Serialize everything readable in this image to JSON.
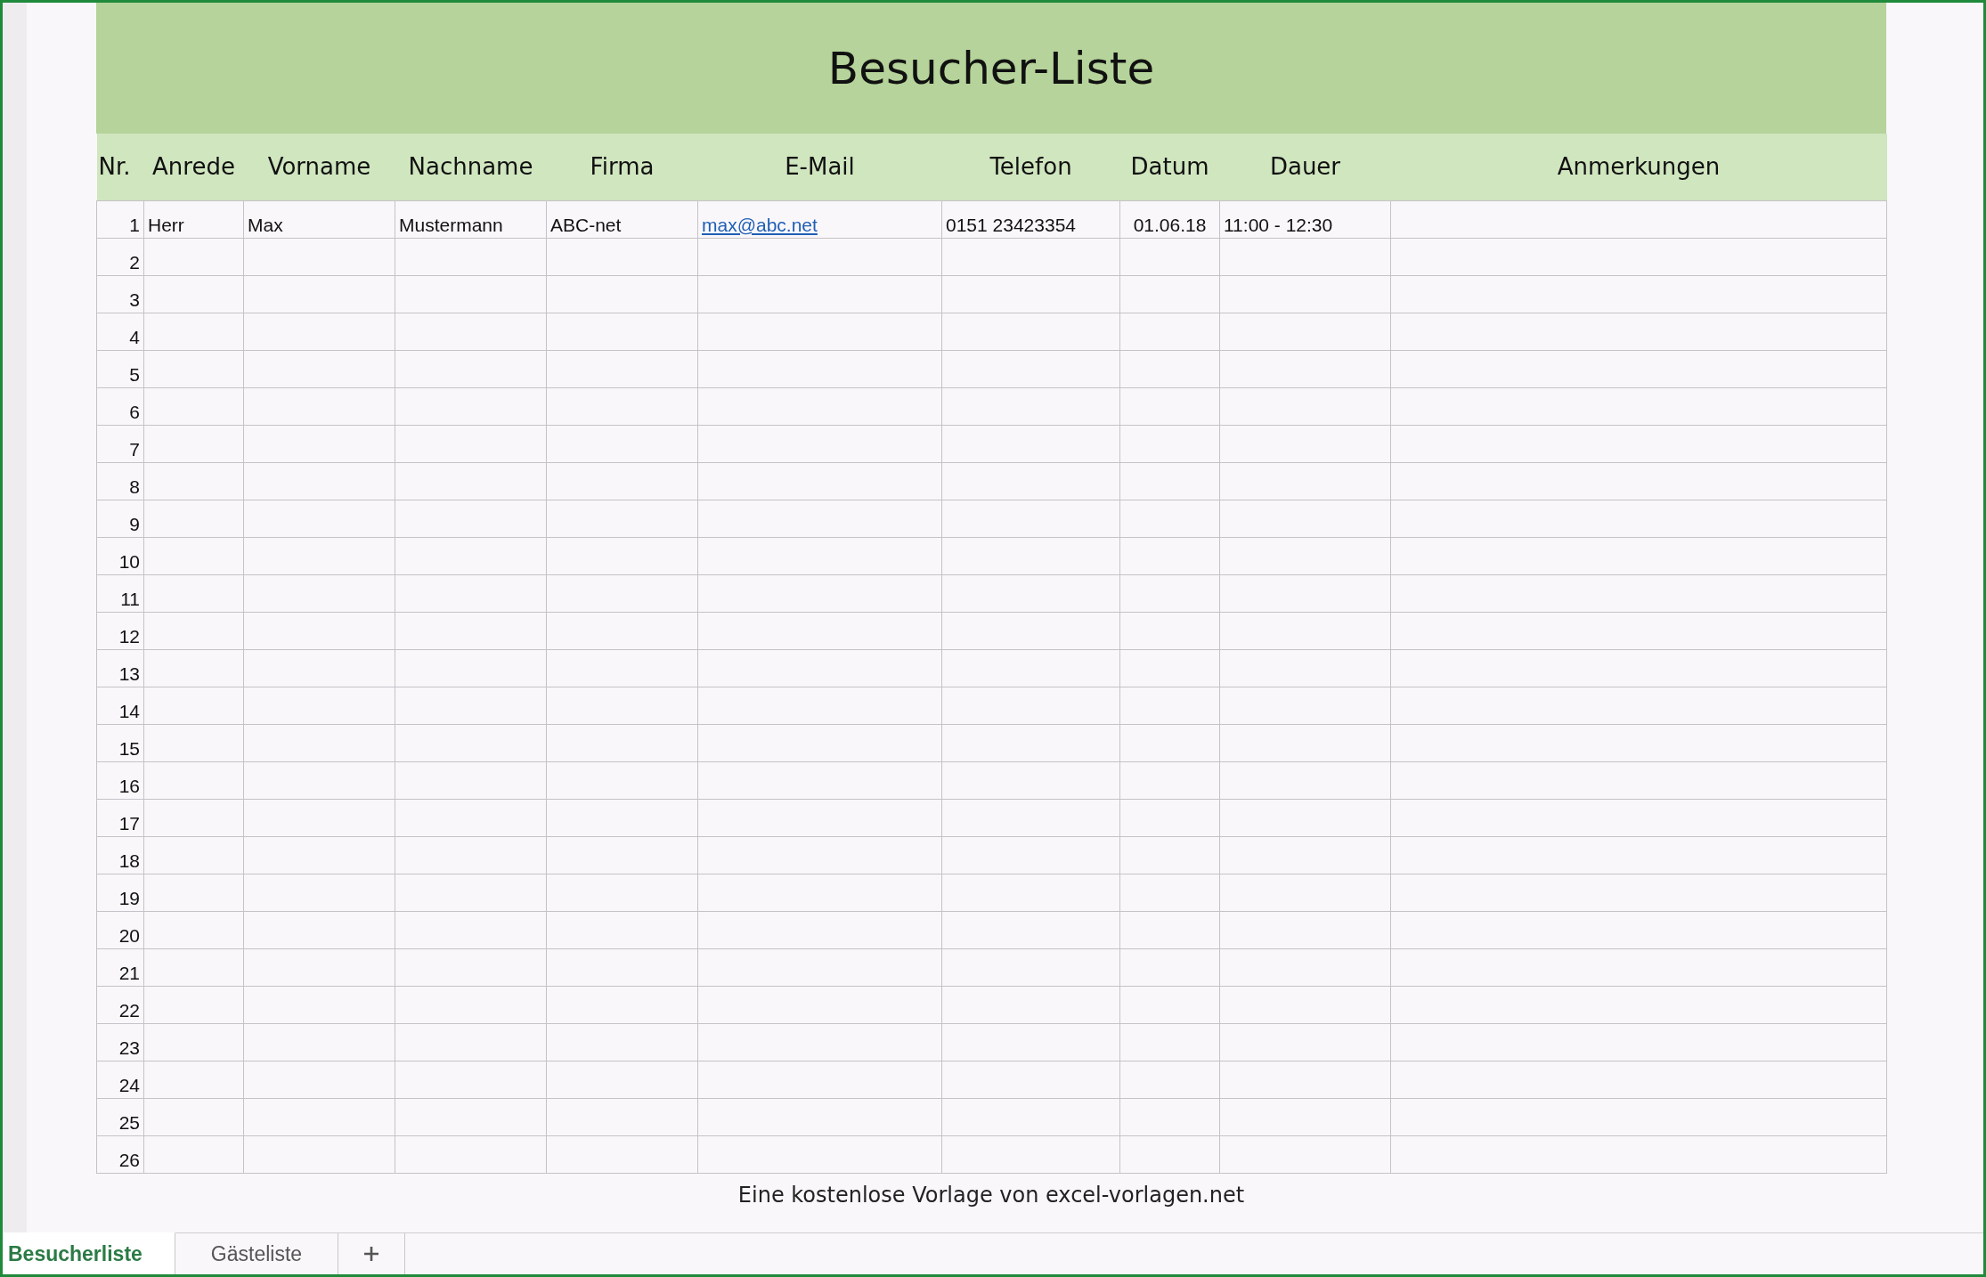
{
  "title": "Besucher-Liste",
  "columns": [
    {
      "label": "Nr.",
      "kind": "number"
    },
    {
      "label": "Anrede",
      "kind": "text"
    },
    {
      "label": "Vorname",
      "kind": "text"
    },
    {
      "label": "Nachname",
      "kind": "text"
    },
    {
      "label": "Firma",
      "kind": "text"
    },
    {
      "label": "E-Mail",
      "kind": "link"
    },
    {
      "label": "Telefon",
      "kind": "text"
    },
    {
      "label": "Datum",
      "kind": "center"
    },
    {
      "label": "Dauer",
      "kind": "text"
    },
    {
      "label": "Anmerkungen",
      "kind": "text"
    }
  ],
  "rows": [
    {
      "cells": [
        "1",
        "Herr",
        "Max",
        "Mustermann",
        "ABC-net",
        "max@abc.net",
        "0151 23423354",
        "01.06.18",
        "11:00 - 12:30"
      ]
    },
    {
      "cells": [
        "2"
      ]
    },
    {
      "cells": [
        "3"
      ]
    },
    {
      "cells": [
        "4"
      ]
    },
    {
      "cells": [
        "5"
      ]
    },
    {
      "cells": [
        "6"
      ]
    },
    {
      "cells": [
        "7"
      ]
    },
    {
      "cells": [
        "8"
      ]
    },
    {
      "cells": [
        "9"
      ]
    },
    {
      "cells": [
        "10"
      ]
    },
    {
      "cells": [
        "11"
      ]
    },
    {
      "cells": [
        "12"
      ]
    },
    {
      "cells": [
        "13"
      ]
    },
    {
      "cells": [
        "14"
      ]
    },
    {
      "cells": [
        "15"
      ]
    },
    {
      "cells": [
        "16"
      ]
    },
    {
      "cells": [
        "17"
      ]
    },
    {
      "cells": [
        "18"
      ]
    },
    {
      "cells": [
        "19"
      ]
    },
    {
      "cells": [
        "20"
      ]
    },
    {
      "cells": [
        "21"
      ]
    },
    {
      "cells": [
        "22"
      ]
    },
    {
      "cells": [
        "23"
      ]
    },
    {
      "cells": [
        "24"
      ]
    },
    {
      "cells": [
        "25"
      ]
    },
    {
      "cells": [
        "26"
      ]
    }
  ],
  "footer": "Eine kostenlose Vorlage von excel-vorlagen.net",
  "sheet_tabs": [
    {
      "label": "Besucherliste",
      "selected": true
    },
    {
      "label": "Gästeliste",
      "selected": false
    }
  ]
}
